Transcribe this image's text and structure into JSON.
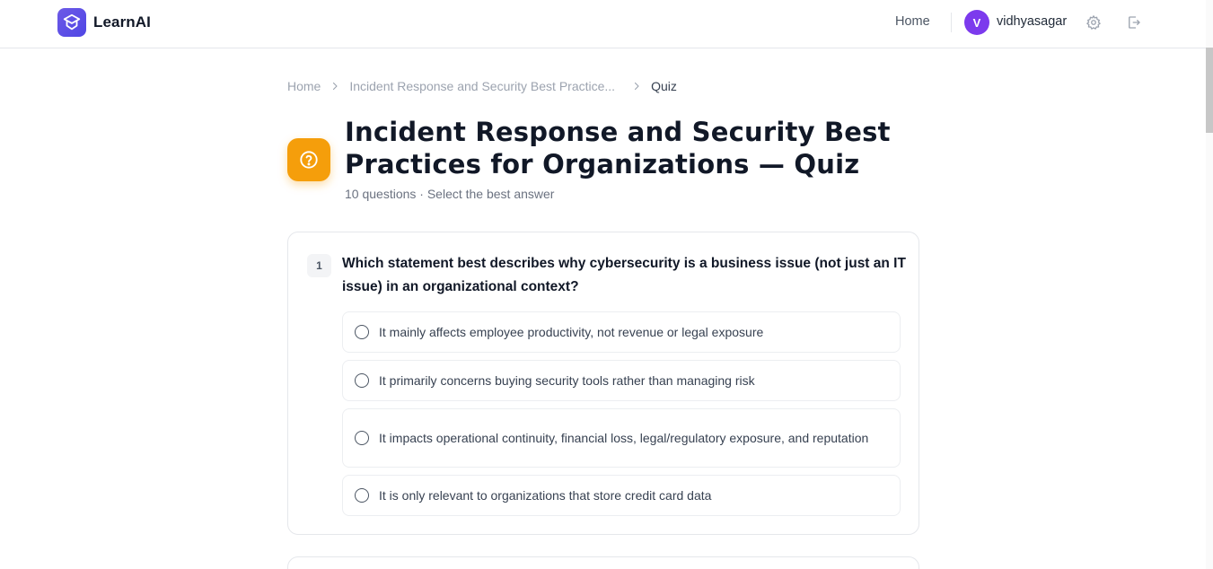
{
  "header": {
    "logo_text": "LearnAI",
    "nav_home": "Home",
    "user_initial": "V",
    "username": "vidhyasagar"
  },
  "breadcrumb": {
    "home": "Home",
    "course": "Incident Response and Security Best Practice...",
    "current": "Quiz"
  },
  "quiz": {
    "title": "Incident Response and Security Best Practices for Organizations — Quiz",
    "subtitle": "10 questions · Select the best answer"
  },
  "questions": [
    {
      "number": "1",
      "text": "Which statement best describes why cybersecurity is a business issue (not just an IT issue) in an organizational context?",
      "options": [
        "It mainly affects employee productivity, not revenue or legal exposure",
        "It primarily concerns buying security tools rather than managing risk",
        "It impacts operational continuity, financial loss, legal/regulatory exposure, and reputation",
        "It is only relevant to organizations that store credit card data"
      ]
    }
  ],
  "colors": {
    "brand": "#4f46e5",
    "avatar": "#7c3aed",
    "quiz_icon": "#f59e0b",
    "border": "#e5e7eb"
  },
  "icons": {
    "logo": "graduation-cap-icon",
    "settings": "gear-icon",
    "logout": "logout-icon",
    "quiz": "question-circle-icon",
    "separator": "chevron-right-icon"
  }
}
